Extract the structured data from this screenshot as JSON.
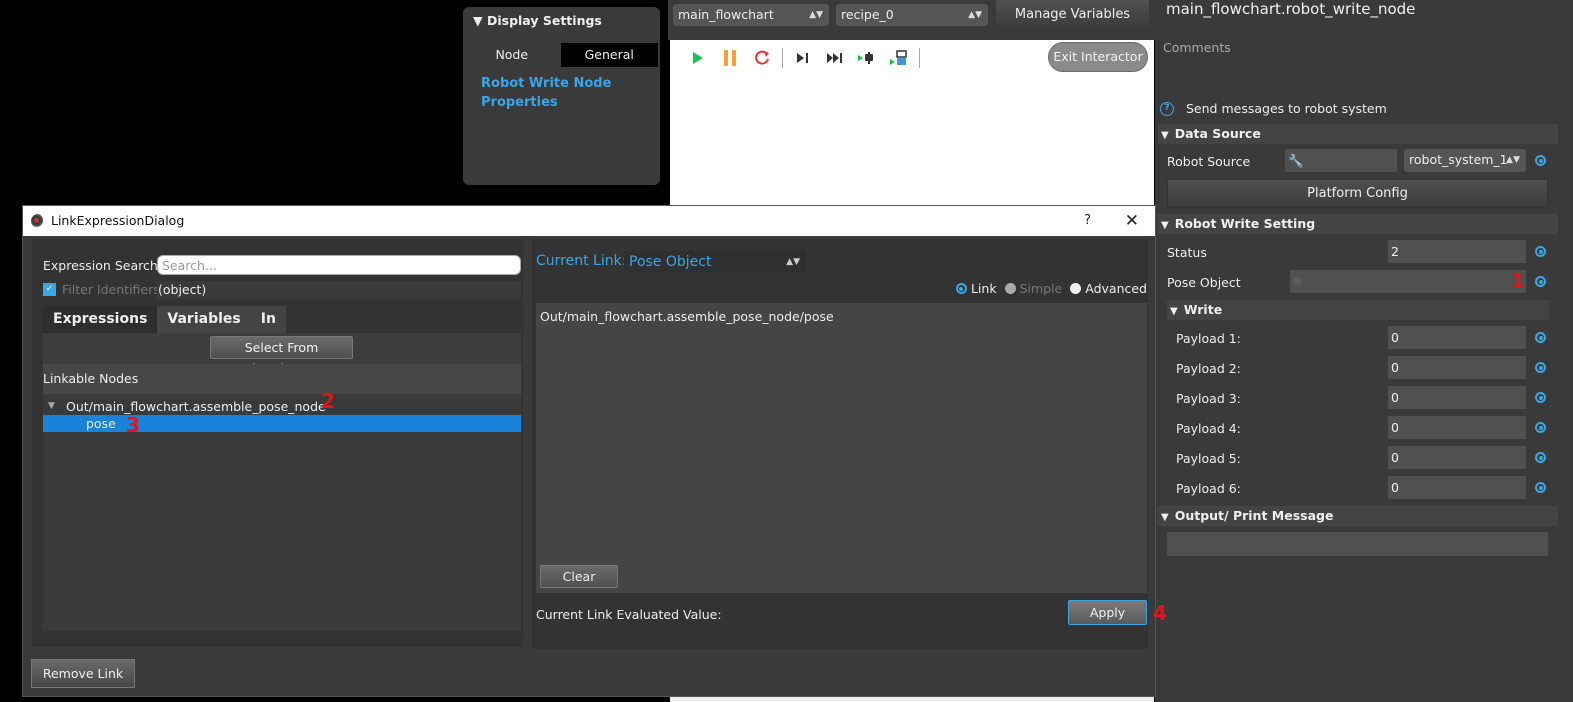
{
  "display_settings": {
    "header": "Display Settings",
    "tabs": [
      "Node",
      "General"
    ],
    "active_tab": "General",
    "link_text": "Robot Write Node Properties"
  },
  "flowchart_toolbar": {
    "flowchart_select": "main_flowchart",
    "recipe_select": "recipe_0",
    "manage_variables_label": "Manage Variables",
    "exit_interactor_label": "Exit Interactor",
    "tools": [
      "play-icon",
      "pause-icon",
      "reset-icon",
      "step-icon",
      "step-all-icon",
      "run-to-node-icon",
      "step-into-node-icon"
    ],
    "colors": {
      "play": "#1fbf4f",
      "pause": "#f5a030",
      "reset": "#e03535"
    }
  },
  "properties": {
    "title": "main_flowchart.robot_write_node",
    "comments_placeholder": "Comments",
    "info_text": "Send messages to robot system",
    "sections": {
      "data_source": "Data Source",
      "robot_write_setting": "Robot Write Setting",
      "write": "Write",
      "output": "Output/ Print Message"
    },
    "robot_source": {
      "label": "Robot Source",
      "value": "robot_system_1"
    },
    "platform_config_label": "Platform Config",
    "status": {
      "label": "Status",
      "value": "2"
    },
    "pose_object": {
      "label": "Pose Object",
      "value": ""
    },
    "payloads": [
      {
        "label": "Payload 1:",
        "value": "0"
      },
      {
        "label": "Payload 2:",
        "value": "0"
      },
      {
        "label": "Payload 3:",
        "value": "0"
      },
      {
        "label": "Payload 4:",
        "value": "0"
      },
      {
        "label": "Payload 5:",
        "value": "0"
      },
      {
        "label": "Payload 6:",
        "value": "0"
      }
    ],
    "output_message": "",
    "accent_color": "#3aa6e8"
  },
  "dialog": {
    "title": "LinkExpressionDialog",
    "help_label": "?",
    "close_label": "✕",
    "expression_search_label": "Expression Search:",
    "search_placeholder": "Search...",
    "filter_identifiers_label": "Filter Identifiers",
    "filter_identifiers_checked": true,
    "filter_type": "(object)",
    "tabs": [
      "Expressions",
      "Variables",
      "In"
    ],
    "active_tab": "Expressions",
    "select_from_flowchart_label": "Select From Flowchart...",
    "linkable_nodes_label": "Linkable Nodes",
    "tree": [
      {
        "label": "Out/main_flowchart.assemble_pose_node",
        "expanded": true,
        "children": [
          {
            "label": "pose",
            "selected": true
          }
        ]
      }
    ],
    "current_link_label": "Current Link:",
    "current_link_value": "Pose Object",
    "modes": [
      "Link",
      "Simple",
      "Advanced"
    ],
    "selected_mode": "Link",
    "expression_text": "Out/main_flowchart.assemble_pose_node/pose",
    "clear_label": "Clear",
    "evaluated_value_label": "Current Link Evaluated Value:",
    "evaluated_value": "",
    "apply_label": "Apply",
    "remove_link_label": "Remove Link"
  },
  "annotations": [
    "1",
    "2",
    "3",
    "4"
  ]
}
